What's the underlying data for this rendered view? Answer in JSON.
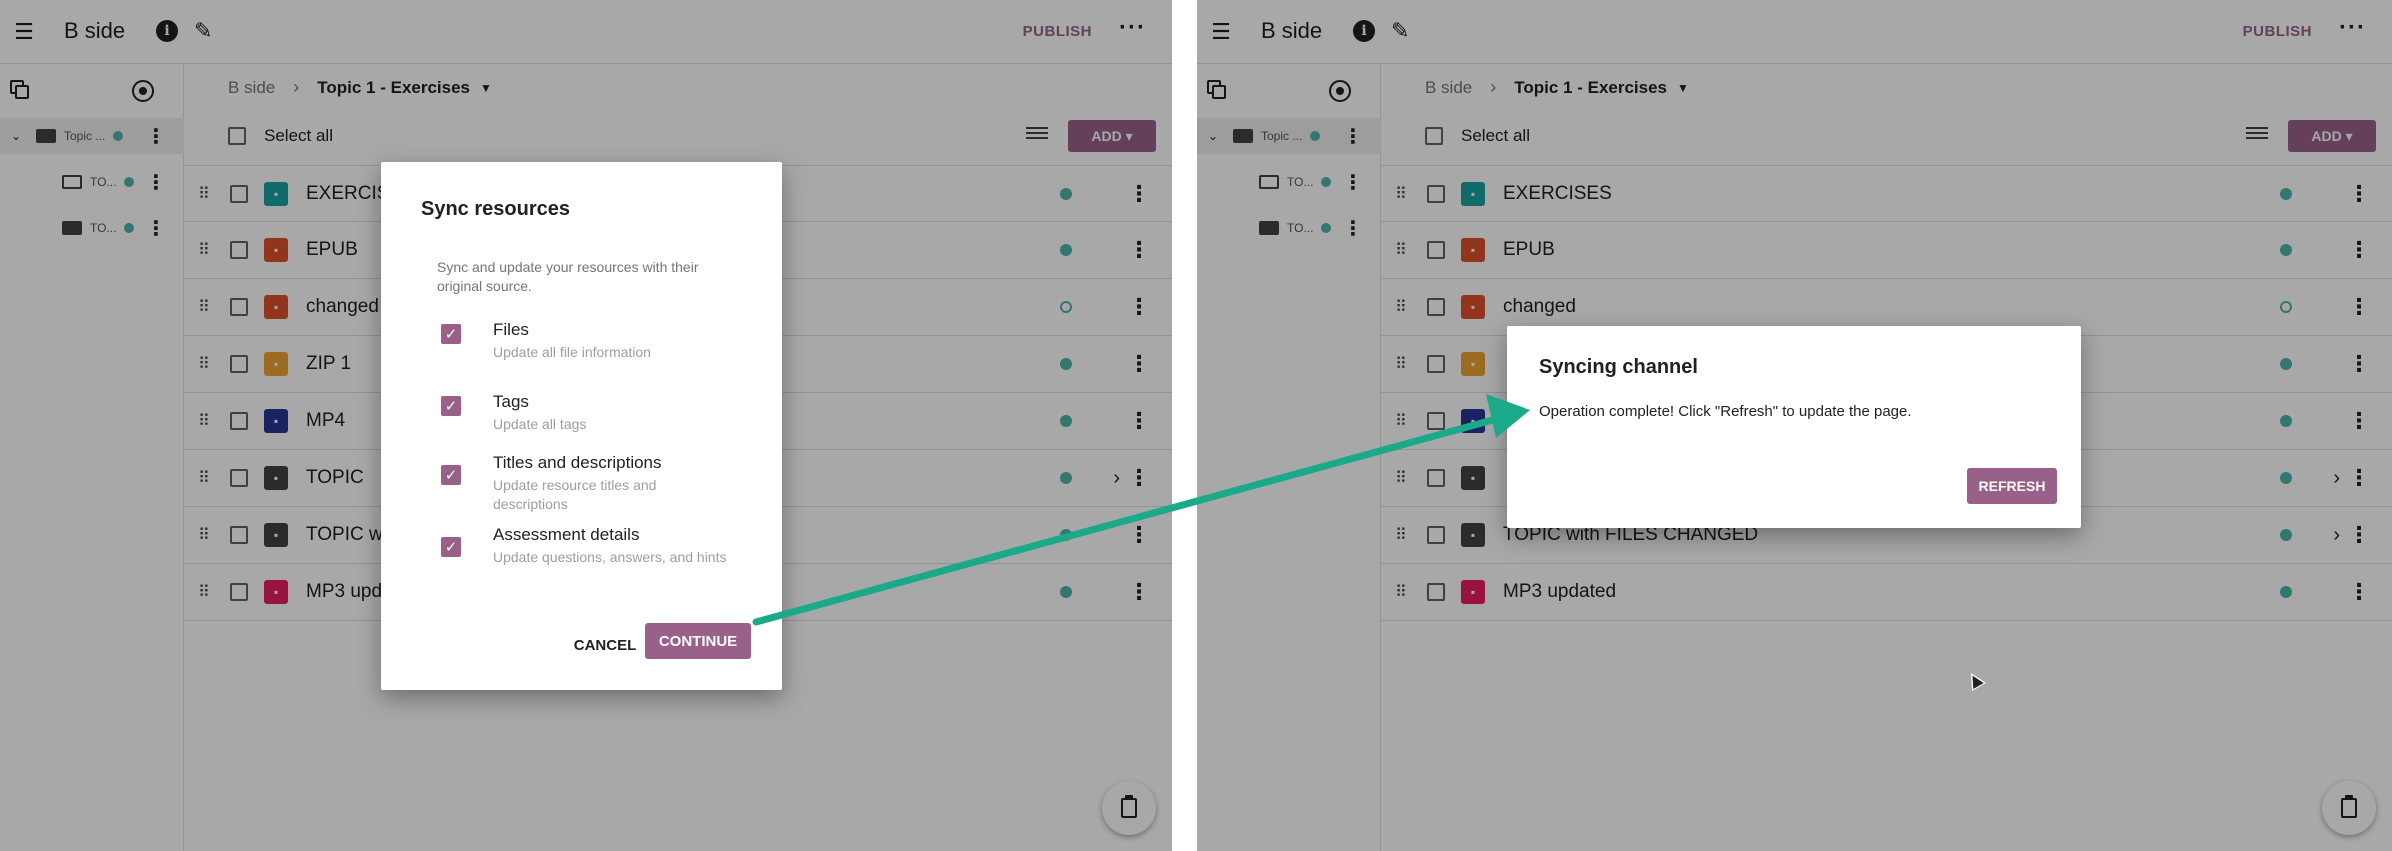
{
  "app": {
    "channel_title": "B side",
    "publish_label": "PUBLISH",
    "more_label": "···"
  },
  "sidebar": {
    "items": [
      {
        "label": "Topic ...",
        "expanded": true,
        "active": true
      },
      {
        "label": "TO...",
        "folder": "outline"
      },
      {
        "label": "TO...",
        "folder": "filled"
      }
    ]
  },
  "breadcrumb": {
    "root": "B side",
    "separator": "›",
    "current": "Topic 1 - Exercises"
  },
  "toolbar": {
    "select_all": "Select all",
    "add_label": "ADD"
  },
  "left_rows": [
    {
      "title": "EXERCIS",
      "kind": "exercise",
      "color": "#1aa3a3",
      "status": "filled"
    },
    {
      "title": "EPUB",
      "kind": "document",
      "color": "#e0512b",
      "status": "filled"
    },
    {
      "title": "changed",
      "kind": "document",
      "color": "#e0512b",
      "status": "hollow"
    },
    {
      "title": "ZIP 1",
      "kind": "html5",
      "color": "#f0a531",
      "status": "filled"
    },
    {
      "title": "MP4",
      "kind": "video",
      "color": "#283593",
      "status": "filled"
    },
    {
      "title": "TOPIC",
      "kind": "topic",
      "color": "#424242",
      "status": "filled",
      "chevron": true
    },
    {
      "title": "TOPIC w",
      "kind": "topic",
      "color": "#424242",
      "status": "filled"
    },
    {
      "title": "MP3 upd",
      "kind": "audio",
      "color": "#e91e63",
      "status": "filled"
    }
  ],
  "right_rows": [
    {
      "title": "EXERCISES",
      "kind": "exercise",
      "color": "#1aa3a3",
      "status": "filled"
    },
    {
      "title": "EPUB",
      "kind": "document",
      "color": "#e0512b",
      "status": "filled"
    },
    {
      "title": "changed",
      "kind": "document",
      "color": "#e0512b",
      "status": "hollow"
    },
    {
      "title": "",
      "kind": "html5",
      "color": "#f0a531",
      "status": "filled"
    },
    {
      "title": "",
      "kind": "video",
      "color": "#283593",
      "status": "filled"
    },
    {
      "title": "",
      "kind": "topic",
      "color": "#424242",
      "status": "filled",
      "chevron": true
    },
    {
      "title": "TOPIC with FILES CHANGED",
      "kind": "topic",
      "color": "#424242",
      "status": "filled",
      "chevron": true
    },
    {
      "title": "MP3 updated",
      "kind": "audio",
      "color": "#e91e63",
      "status": "filled"
    }
  ],
  "sync_dialog": {
    "title": "Sync resources",
    "description": "Sync and update your resources with their original source.",
    "options": [
      {
        "title": "Files",
        "subtitle": "Update all file information",
        "checked": true
      },
      {
        "title": "Tags",
        "subtitle": "Update all tags",
        "checked": true
      },
      {
        "title": "Titles and descriptions",
        "subtitle": "Update resource titles and descriptions",
        "checked": true
      },
      {
        "title": "Assessment details",
        "subtitle": "Update questions, answers, and hints",
        "checked": true
      }
    ],
    "cancel_label": "CANCEL",
    "continue_label": "CONTINUE"
  },
  "syncing_dialog": {
    "title": "Syncing channel",
    "message": "Operation complete! Click \"Refresh\" to update the page.",
    "refresh_label": "REFRESH"
  },
  "colors": {
    "accent": "#996189",
    "status_green": "#4db6ac",
    "arrow": "#1aaa8a"
  }
}
